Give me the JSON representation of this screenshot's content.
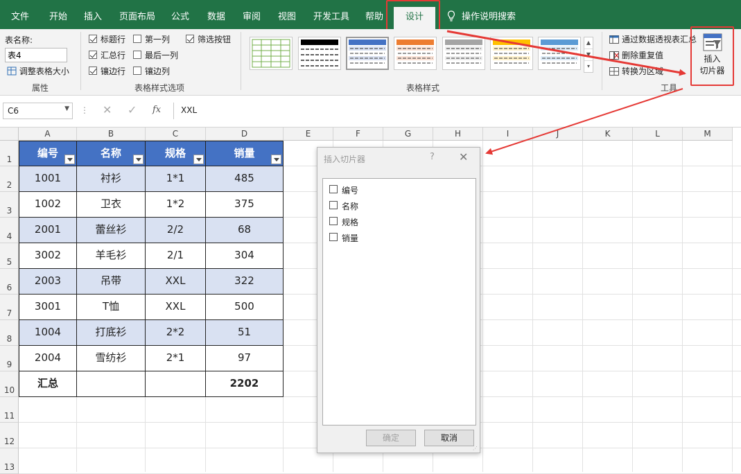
{
  "ribbon_tabs": [
    "文件",
    "开始",
    "插入",
    "页面布局",
    "公式",
    "数据",
    "审阅",
    "视图",
    "开发工具",
    "帮助",
    "设计"
  ],
  "active_tab": "设计",
  "tell_me": "操作说明搜索",
  "properties": {
    "table_name_label": "表名称:",
    "table_name_value": "表4",
    "resize_label": "调整表格大小",
    "group_label": "属性"
  },
  "style_options": {
    "header_row": "标题行",
    "total_row": "汇总行",
    "banded_rows": "镶边行",
    "first_column": "第一列",
    "last_column": "最后一列",
    "banded_columns": "镶边列",
    "filter_button": "筛选按钮",
    "group_label": "表格样式选项"
  },
  "table_styles": {
    "group_label": "表格样式"
  },
  "tools": {
    "pivot": "通过数据透视表汇总",
    "remove_dup": "删除重复值",
    "convert": "转换为区域",
    "group_label": "工具",
    "insert_slicer_line1": "插入",
    "insert_slicer_line2": "切片器"
  },
  "formula_bar": {
    "name_box": "C6",
    "value": "XXL",
    "fx": "fx"
  },
  "columns": [
    "A",
    "B",
    "C",
    "D",
    "E",
    "F",
    "G",
    "H",
    "I",
    "J",
    "K",
    "L",
    "M"
  ],
  "rows": [
    "1",
    "2",
    "3",
    "4",
    "5",
    "6",
    "7",
    "8",
    "9",
    "10",
    "11",
    "12",
    "13"
  ],
  "table": {
    "headers": [
      "编号",
      "名称",
      "规格",
      "销量"
    ],
    "rows": [
      [
        "1001",
        "衬衫",
        "1*1",
        "485"
      ],
      [
        "1002",
        "卫衣",
        "1*2",
        "375"
      ],
      [
        "2001",
        "蕾丝衫",
        "2/2",
        "68"
      ],
      [
        "3002",
        "羊毛衫",
        "2/1",
        "304"
      ],
      [
        "2003",
        "吊带",
        "XXL",
        "322"
      ],
      [
        "3001",
        "T恤",
        "XXL",
        "500"
      ],
      [
        "1004",
        "打底衫",
        "2*2",
        "51"
      ],
      [
        "2004",
        "雪纺衫",
        "2*1",
        "97"
      ]
    ],
    "total_row": [
      "汇总",
      "",
      "",
      "2202"
    ]
  },
  "dialog": {
    "title": "插入切片器",
    "help": "?",
    "items": [
      "编号",
      "名称",
      "规格",
      "销量"
    ],
    "ok": "确定",
    "cancel": "取消"
  },
  "colors": {
    "ribbon_green": "#217346",
    "table_header": "#4472c4",
    "table_band": "#d9e1f2",
    "annotation_red": "#e53935"
  }
}
